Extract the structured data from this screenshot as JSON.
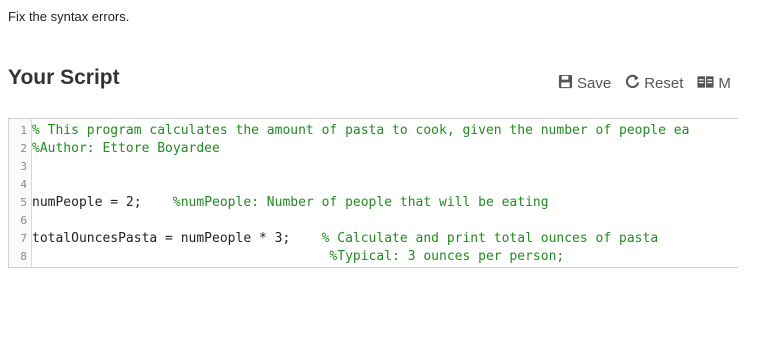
{
  "instruction": "Fix the syntax errors.",
  "header": {
    "title": "Your Script",
    "toolbar": {
      "save_label": "Save",
      "reset_label": "Reset",
      "reference_label": "M"
    }
  },
  "editor": {
    "lines": [
      {
        "number": "1",
        "code": "",
        "comment": "% This program calculates the amount of pasta to cook, given the number of people ea"
      },
      {
        "number": "2",
        "code": "",
        "comment": "%Author: Ettore Boyardee"
      },
      {
        "number": "3",
        "code": "",
        "comment": ""
      },
      {
        "number": "4",
        "code": "",
        "comment": ""
      },
      {
        "number": "5",
        "code": "numPeople = 2;    ",
        "comment": "%numPeople: Number of people that will be eating"
      },
      {
        "number": "6",
        "code": "",
        "comment": ""
      },
      {
        "number": "7",
        "code": "totalOuncesPasta = numPeople * 3;    ",
        "comment": "% Calculate and print total ounces of pasta"
      },
      {
        "number": "8",
        "code": "                                      ",
        "comment": "%Typical: 3 ounces per person;"
      }
    ]
  }
}
